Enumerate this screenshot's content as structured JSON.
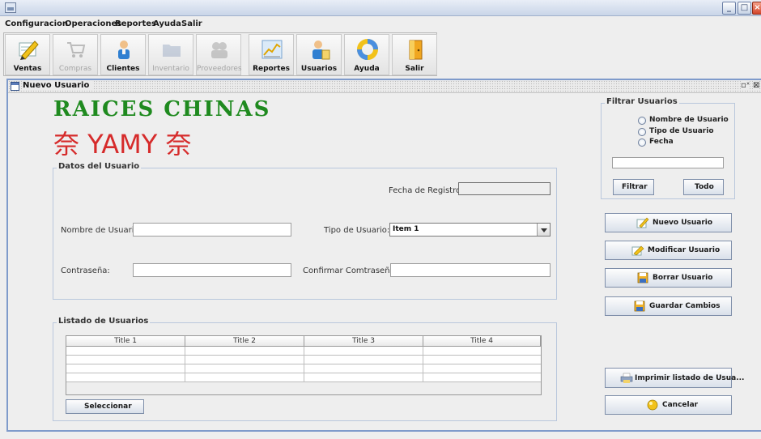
{
  "menu": [
    "Configuracion",
    "Operaciones",
    "Reportes",
    "Ayuda",
    "Salir"
  ],
  "toolbar": [
    {
      "label": "Ventas",
      "icon": "pencil-icon",
      "enabled": true
    },
    {
      "label": "Compras",
      "icon": "cart-icon",
      "enabled": false
    },
    {
      "label": "Clientes",
      "icon": "user-icon",
      "enabled": true
    },
    {
      "label": "Inventario",
      "icon": "folder-icon",
      "enabled": false
    },
    {
      "label": "Proveedores",
      "icon": "group-icon",
      "enabled": false
    },
    {
      "label": "Reportes",
      "icon": "chart-icon",
      "enabled": true
    },
    {
      "label": "Usuarios",
      "icon": "users-icon",
      "enabled": true
    },
    {
      "label": "Ayuda",
      "icon": "help-ring-icon",
      "enabled": true
    },
    {
      "label": "Salir",
      "icon": "exit-door-icon",
      "enabled": true
    }
  ],
  "frame": {
    "title": "Nuevo Usuario",
    "controls": "ᵍˣ"
  },
  "logo": {
    "title": "RAICES CHINAS",
    "subtitle": "奈 YAMY 奈",
    "colors": {
      "title": "#1f8a1f",
      "subtitle": "#d62b2b"
    }
  },
  "datos": {
    "group_title": "Datos del Usuario",
    "fecha_label": "Fecha de Registro:",
    "fecha_value": "",
    "nombre_label": "Nombre de Usuario:",
    "nombre_value": "",
    "tipo_label": "Tipo de Usuario:",
    "tipo_value": "Item 1",
    "contrasena_label": "Contraseña:",
    "contrasena_value": "",
    "confirmar_label": "Confirmar Comtraseña:",
    "confirmar_value": ""
  },
  "listado": {
    "group_title": "Listado de Usuarios",
    "columns": [
      "Title 1",
      "Title 2",
      "Title 3",
      "Title 4"
    ],
    "row_count": 4,
    "seleccionar": "Seleccionar"
  },
  "filtrar": {
    "group_title": "Filtrar Usuarios",
    "options": [
      "Nombre de Usuario",
      "Tipo de Usuario",
      "Fecha"
    ],
    "search_value": "",
    "filtrar_button": "Filtrar",
    "todo_button": "Todo"
  },
  "actions": {
    "nuevo": "Nuevo Usuario",
    "modificar": "Modificar Usuario",
    "borrar": "Borrar Usuario",
    "guardar": "Guardar Cambios",
    "imprimir": "Imprimir listado de Usua...",
    "cancelar": "Cancelar"
  }
}
